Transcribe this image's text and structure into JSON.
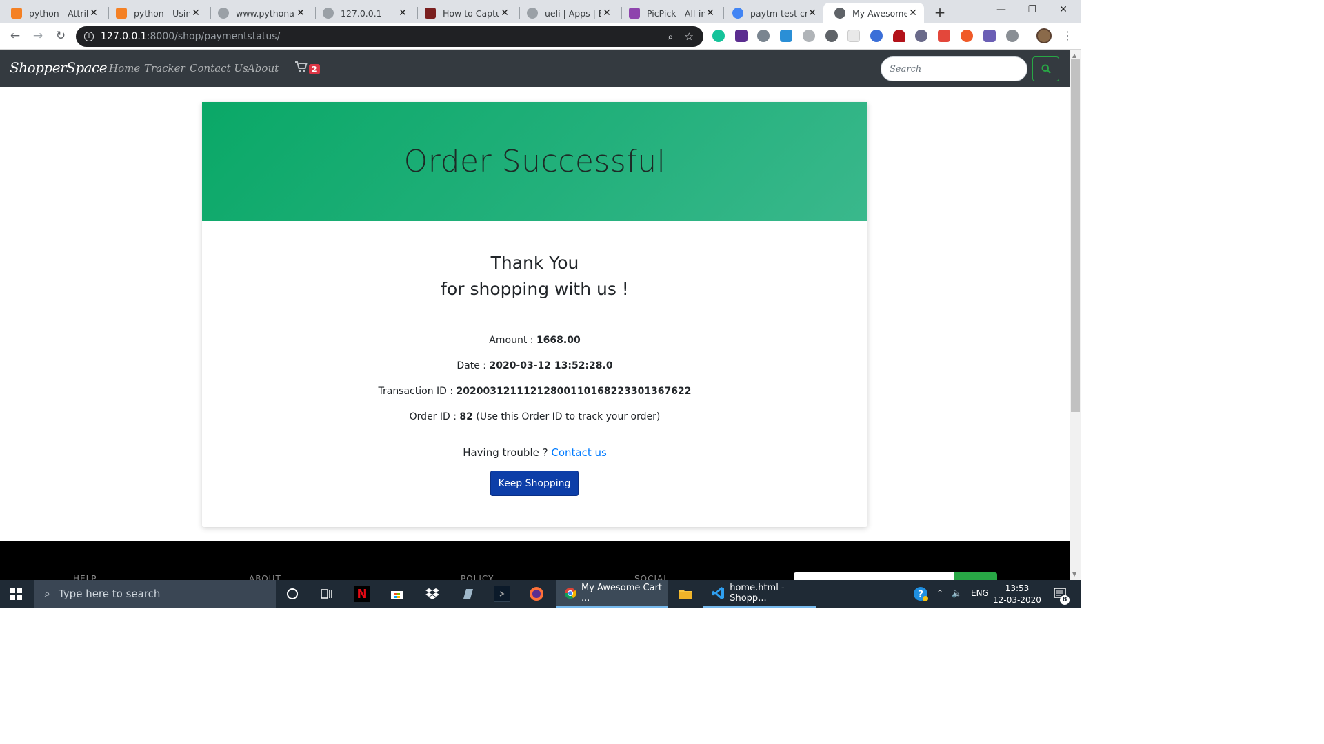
{
  "browser": {
    "tabs": [
      {
        "label": "python - Attrib",
        "favicon_color": "#f48024"
      },
      {
        "label": "python - Using",
        "favicon_color": "#f48024"
      },
      {
        "label": "www.pythonan",
        "favicon_color": "#5f6368"
      },
      {
        "label": "127.0.0.1",
        "favicon_color": "#5f6368"
      },
      {
        "label": "How to Captur",
        "favicon_color": "#c0392b"
      },
      {
        "label": "ueli | Apps | Ele",
        "favicon_color": "#5f6368"
      },
      {
        "label": "PicPick - All-in-",
        "favicon_color": "#8e44ad"
      },
      {
        "label": "paytm test cre",
        "favicon_color": "#4285f4"
      },
      {
        "label": "My Awesome C",
        "favicon_color": "#5f6368"
      }
    ],
    "close_glyph": "✕",
    "new_tab_glyph": "+",
    "url_host": "127.0.0.1",
    "url_path": ":8000/shop/paymentstatus/",
    "window_controls": [
      "—",
      "❐",
      "✕"
    ]
  },
  "site": {
    "brand": "ShopperSpace",
    "nav_links": [
      "Home",
      "Tracker",
      "Contact Us",
      "About"
    ],
    "cart_count": "2",
    "search_placeholder": "Search",
    "accent_color": "#28a745"
  },
  "order": {
    "heading": "Order Successful",
    "thanks_line1": "Thank You",
    "thanks_line2": "for shopping with us !",
    "amount_label": "Amount : ",
    "amount_value": "1668.00",
    "date_label": "Date : ",
    "date_value": "2020-03-12 13:52:28.0",
    "txn_label": "Transaction ID : ",
    "txn_value": "20200312111212800110168223301367622",
    "order_label": "Order ID : ",
    "order_value": "82",
    "order_note": " (Use this Order ID to track your order)",
    "trouble_text": "Having trouble ? ",
    "contact_link": "Contact us",
    "keep_shopping": "Keep Shopping"
  },
  "footer": {
    "headings": [
      "HELP",
      "ABOUT",
      "POLICY",
      "SOCIAL"
    ]
  },
  "taskbar": {
    "search_placeholder": "Type here to search",
    "apps": [
      {
        "label": "My Awesome Cart ..."
      },
      {
        "label": "home.html - Shopp..."
      }
    ],
    "language": "ENG",
    "time": "13:53",
    "date": "12-03-2020",
    "notification_count": "8"
  }
}
